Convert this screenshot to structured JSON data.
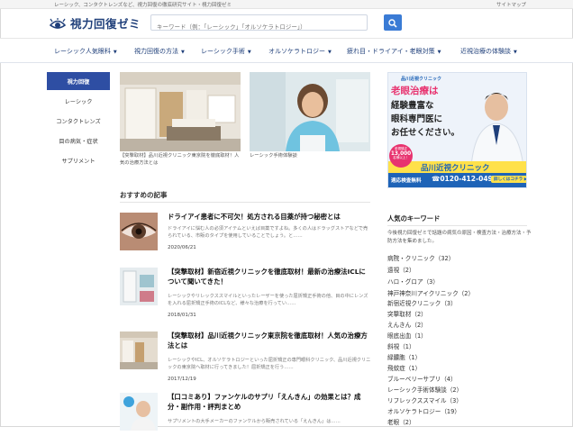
{
  "topbar": {
    "tagline": "レーシック、コンタクトレンズなど、視力回復の徹底研究サイト・視力回復ゼミ",
    "sitemap": "サイトマップ"
  },
  "brand": {
    "logo_icon": "eye-logo-icon",
    "title": "視力回復ゼミ",
    "accent": "#1f3f7a"
  },
  "search": {
    "placeholder": "キーワード（例：「レーシック」「オルソケラトロジー」）",
    "button_icon": "search-icon",
    "button_color": "#3a7bd5"
  },
  "nav": [
    {
      "label": "レーシック人気眼科"
    },
    {
      "label": "視力回復の方法"
    },
    {
      "label": "レーシック手術"
    },
    {
      "label": "オルソケラトロジー"
    },
    {
      "label": "疲れ目・ドライアイ・老眼対策"
    },
    {
      "label": "近視治療の体験談"
    }
  ],
  "sidebar": {
    "active_color": "#2e4ea3",
    "items": [
      {
        "label": "視力回復",
        "active": true
      },
      {
        "label": "レーシック"
      },
      {
        "label": "コンタクトレンズ"
      },
      {
        "label": "目の病気・症状"
      },
      {
        "label": "サプリメント"
      }
    ]
  },
  "featured": [
    {
      "caption": "【突撃取材】品川近視クリニック東京院を徹底取材！人気の治療方法とは"
    },
    {
      "caption": "レーシック手術体験談"
    }
  ],
  "recommended": {
    "heading": "おすすめの記事",
    "articles": [
      {
        "title": "ドライアイ患者に不可欠！処方される目薬が持つ秘密とは",
        "excerpt": "ドライアイに悩む人の必須アイテムといえば目薬ですよね。多くの人はドラッグストアなどで売られている、市販のタイプを使用していることでしょう。と……",
        "date": "2020/06/21"
      },
      {
        "title": "【突撃取材】新宿近視クリニックを徹底取材！最新の治療法ICLについて聞いてきた！",
        "excerpt": "レーシックやリレックススマイルといったレーザーを使った屈折矯正手術の他、目の中にレンズを入れる屈折矯正手術のICLなど、様々な治療を行ってい……",
        "date": "2018/01/31"
      },
      {
        "title": "【突撃取材】品川近視クリニック東京院を徹底取材！人気の治療方法とは",
        "excerpt": "レーシックやICL、オルソケラトロジーといった屈折矯正の専門眼科クリニック、品川近視クリニックの東京院へ取材に行ってきました！屈折矯正を行う……",
        "date": "2017/12/19"
      },
      {
        "title": "【口コミあり】ファンケルのサプリ「えんきん」の効果とは？成分・副作用・評判まとめ",
        "excerpt": "サプリメントの大手メーカーのファンケルから販売されている「えんきん」は……",
        "date": ""
      }
    ]
  },
  "ad": {
    "clinic_small": "品川近視クリニック",
    "headline": "老眼治療は",
    "body": [
      "経験豊富な",
      "眼科専門医に",
      "お任せください。"
    ],
    "badge": [
      "老視矯正",
      "13,000",
      "名様以上！"
    ],
    "clinic_name": "品川近視クリニック",
    "free_exam": "適応検査無料",
    "phone": "0120-412-049",
    "more": "詳しくはコチラ ▶",
    "colors": {
      "pink": "#e8336f",
      "blue": "#1e63b7",
      "yellow": "#ffe14a"
    }
  },
  "keywords": {
    "heading": "人気のキーワード",
    "description": "今後視力回復ゼミで話題の病気の原因・検査方法・治療方法・予防方法を集めました。",
    "items": [
      {
        "label": "病院・クリニック",
        "count": "（32）"
      },
      {
        "label": "遠視",
        "count": "（2）"
      },
      {
        "label": "ハロ・グロア",
        "count": "（3）"
      },
      {
        "label": "神戸神奈川アイクリニック",
        "count": "（2）"
      },
      {
        "label": "新宿近視クリニック",
        "count": "（3）"
      },
      {
        "label": "突撃取材",
        "count": "（2）"
      },
      {
        "label": "えんきん",
        "count": "（2）"
      },
      {
        "label": "眼底出血",
        "count": "（1）"
      },
      {
        "label": "斜視",
        "count": "（1）"
      },
      {
        "label": "緑膿胞",
        "count": "（1）"
      },
      {
        "label": "飛蚊症",
        "count": "（1）"
      },
      {
        "label": "ブルーベリーサプリ",
        "count": "（4）"
      },
      {
        "label": "レーシック手術体験談",
        "count": "（2）"
      },
      {
        "label": "リフレックススマイル",
        "count": "（3）"
      },
      {
        "label": "オルソケラトロジー",
        "count": "（19）"
      },
      {
        "label": "老眼",
        "count": "（2）"
      }
    ]
  }
}
